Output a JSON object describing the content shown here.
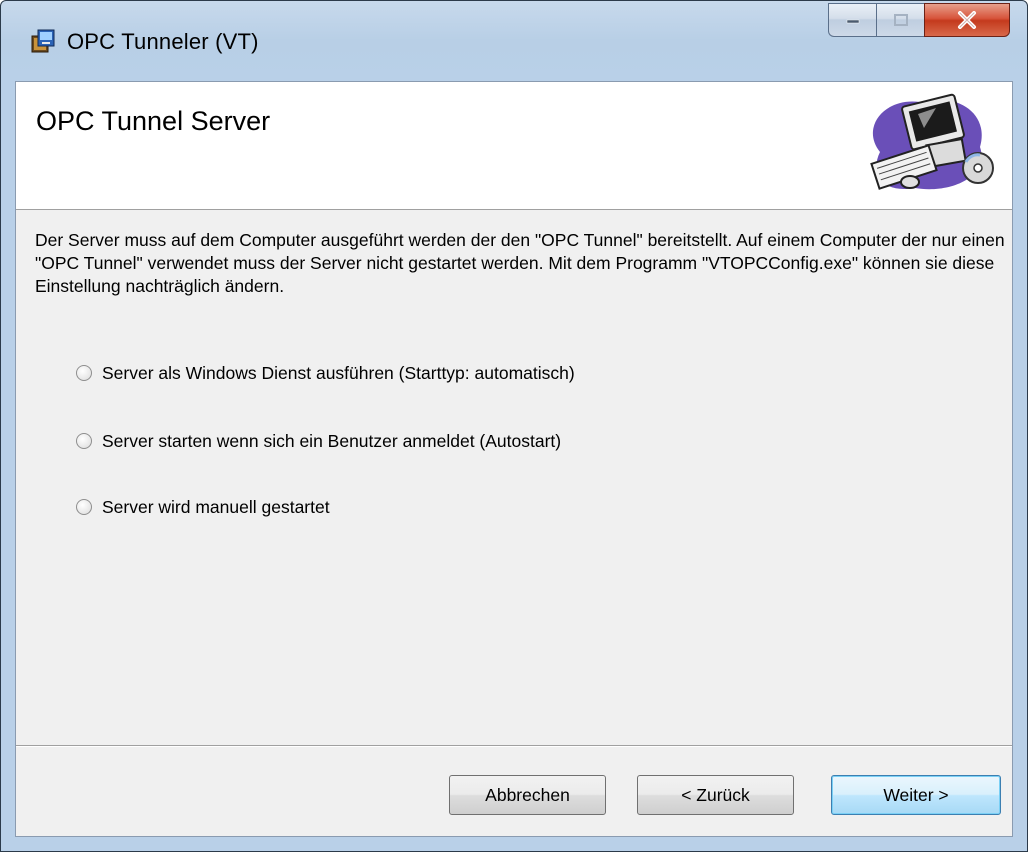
{
  "window": {
    "title": "OPC Tunneler (VT)",
    "close_glyph": "X"
  },
  "banner": {
    "title": "OPC Tunnel Server"
  },
  "description": "Der Server muss auf dem Computer ausgeführt werden der den \"OPC Tunnel\" bereitstellt. Auf einem Computer der nur einen \"OPC Tunnel\" verwendet muss der Server nicht gestartet werden. Mit dem Programm \"VTOPCConfig.exe\" können sie diese Einstellung nachträglich ändern.",
  "options": [
    {
      "label": "Server als Windows Dienst ausführen (Starttyp: automatisch)",
      "checked": true
    },
    {
      "label": "Server starten wenn sich ein Benutzer anmeldet (Autostart)",
      "checked": false
    },
    {
      "label": "Server wird manuell gestartet",
      "checked": false
    }
  ],
  "buttons": {
    "cancel": "Abbrechen",
    "back": "< Zurück",
    "next": "Weiter >"
  },
  "icons": {
    "app": "installer-icon",
    "banner": "computer-setup-icon",
    "minimize": "minimize-icon",
    "maximize": "maximize-icon",
    "close": "close-icon"
  },
  "colors": {
    "title_bar": "#b9d0e8",
    "client_background": "#f0f0f0",
    "close_button": "#c43a1d",
    "default_button": "#bee6fd"
  }
}
